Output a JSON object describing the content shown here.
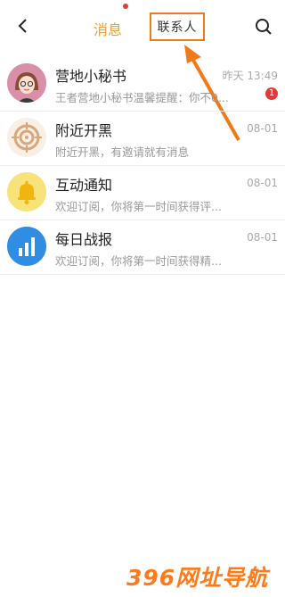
{
  "header": {
    "back_icon": "chevron-left-icon",
    "tab_messages": "消息",
    "tab_contacts": "联系人",
    "search_icon": "search-icon"
  },
  "conversations": [
    {
      "name": "营地小秘书",
      "preview": "王者营地小秘书温馨提醒：你不0...",
      "time": "昨天 13:49",
      "badge": "1",
      "avatar": "girl-avatar"
    },
    {
      "name": "附近开黑",
      "preview": "附近开黑，有邀请就有消息",
      "time": "08-01",
      "avatar": "target-icon"
    },
    {
      "name": "互动通知",
      "preview": "欢迎订阅，你将第一时间获得评...",
      "time": "08-01",
      "avatar": "bell-icon"
    },
    {
      "name": "每日战报",
      "preview": "欢迎订阅，你将第一时间获得精...",
      "time": "08-01",
      "avatar": "bar-chart-icon"
    }
  ],
  "watermark": "396网址导航",
  "colors": {
    "accent": "#f0a030",
    "highlight": "#f07a1a",
    "badge": "#e53935",
    "bell_bg": "#f7e27a",
    "chart_bg": "#2f8de4"
  }
}
